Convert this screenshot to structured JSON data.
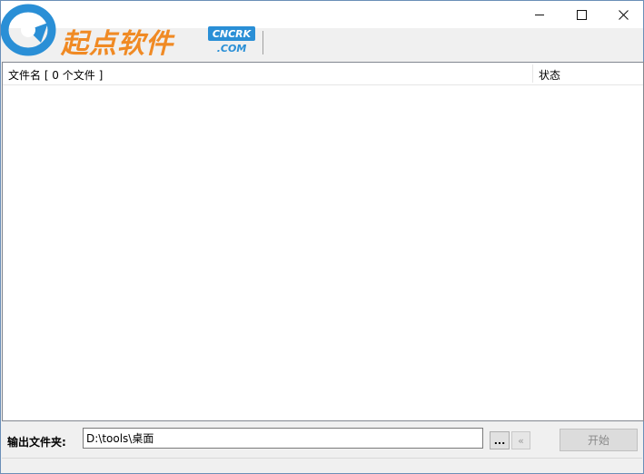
{
  "window": {
    "logo_text": "起点软件",
    "logo_badge_top": "CNCRK",
    "logo_badge_bottom": ".COM",
    "colors": {
      "accent": "#2a8fd6",
      "logo_orange": "#f08a24"
    }
  },
  "caption": {
    "minimize_icon": "minimize-icon",
    "maximize_icon": "maximize-icon",
    "close_icon": "close-icon"
  },
  "list": {
    "columns": [
      {
        "label": "文件名 [ 0 个文件 ]"
      },
      {
        "label": "状态"
      }
    ],
    "rows": []
  },
  "output": {
    "label": "输出文件夹:",
    "path": "D:\\tools\\桌面",
    "browse_label": "...",
    "back_label": "«"
  },
  "actions": {
    "start_label": "开始"
  }
}
